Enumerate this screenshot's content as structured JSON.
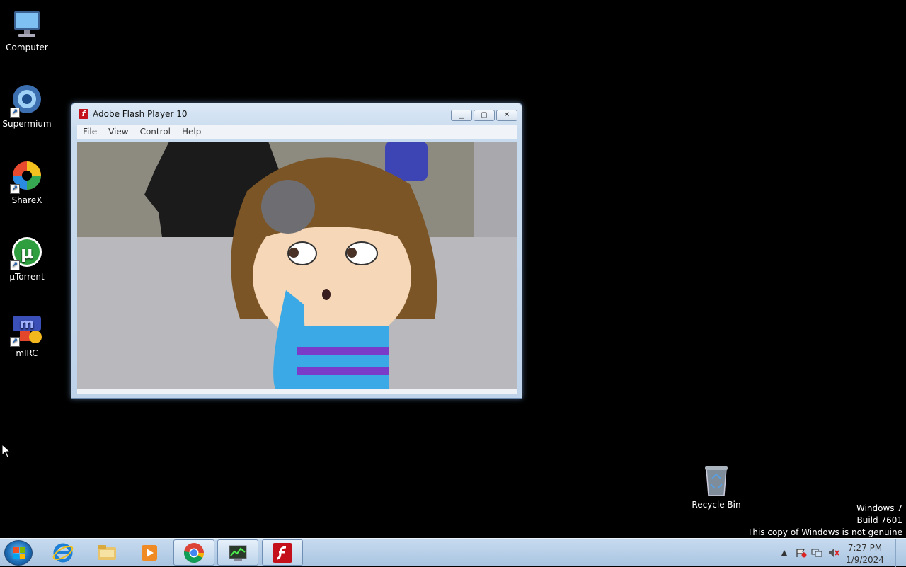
{
  "desktop": {
    "icons": [
      {
        "label": "Computer",
        "icon": "computer-icon"
      },
      {
        "label": "Supermium",
        "icon": "supermium-icon"
      },
      {
        "label": "ShareX",
        "icon": "sharex-icon"
      },
      {
        "label": "μTorrent",
        "icon": "utorrent-icon"
      },
      {
        "label": "mIRC",
        "icon": "mirc-icon"
      }
    ],
    "recycle_bin": {
      "label": "Recycle Bin",
      "icon": "recycle-bin-icon"
    }
  },
  "window": {
    "title": "Adobe Flash Player 10",
    "icon": "flash-icon",
    "menu": [
      "File",
      "View",
      "Control",
      "Help"
    ]
  },
  "watermark": {
    "line1": "Windows 7",
    "line2": "Build 7601",
    "line3": "This copy of Windows is not genuine"
  },
  "taskbar": {
    "pinned": [
      {
        "icon": "internet-explorer-icon"
      },
      {
        "icon": "file-explorer-icon"
      },
      {
        "icon": "media-player-icon"
      },
      {
        "icon": "chrome-icon"
      },
      {
        "icon": "task-manager-icon"
      },
      {
        "icon": "flash-player-icon"
      }
    ],
    "clock": {
      "time": "7:27 PM",
      "date": "1/9/2024"
    }
  },
  "colors": {
    "desktop_bg": "#000000",
    "taskbar": "#b4cde6",
    "flash_red": "#c4101a"
  }
}
